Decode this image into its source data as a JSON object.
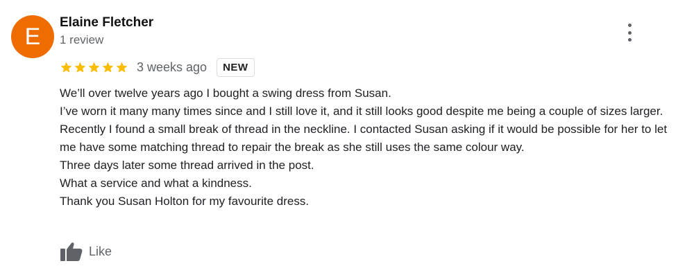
{
  "review": {
    "avatar_letter": "E",
    "avatar_color": "#ef6c00",
    "reviewer_name": "Elaine Fletcher",
    "review_count": "1 review",
    "rating": 5,
    "rating_max": 5,
    "star_color": "#fbbc04",
    "time_ago": "3 weeks ago",
    "badge": "NEW",
    "paragraphs": [
      "We’ll over twelve years ago I bought a swing dress from  Susan.",
      "I’ve worn it many many times since and I still love it, and it still looks good despite me being a couple of sizes larger.",
      "Recently I found a small break of thread in the neckline. I contacted Susan asking if it would be possible for her to let me have some matching thread to repair the break as she still uses the same colour way.",
      "Three days later some thread arrived in the post.",
      "What a service and what a kindness.",
      "Thank you Susan Holton for my favourite dress."
    ],
    "like_label": "Like",
    "icons": {
      "more": "more-vert-icon",
      "star": "star-icon",
      "like": "thumbs-up-icon"
    }
  }
}
